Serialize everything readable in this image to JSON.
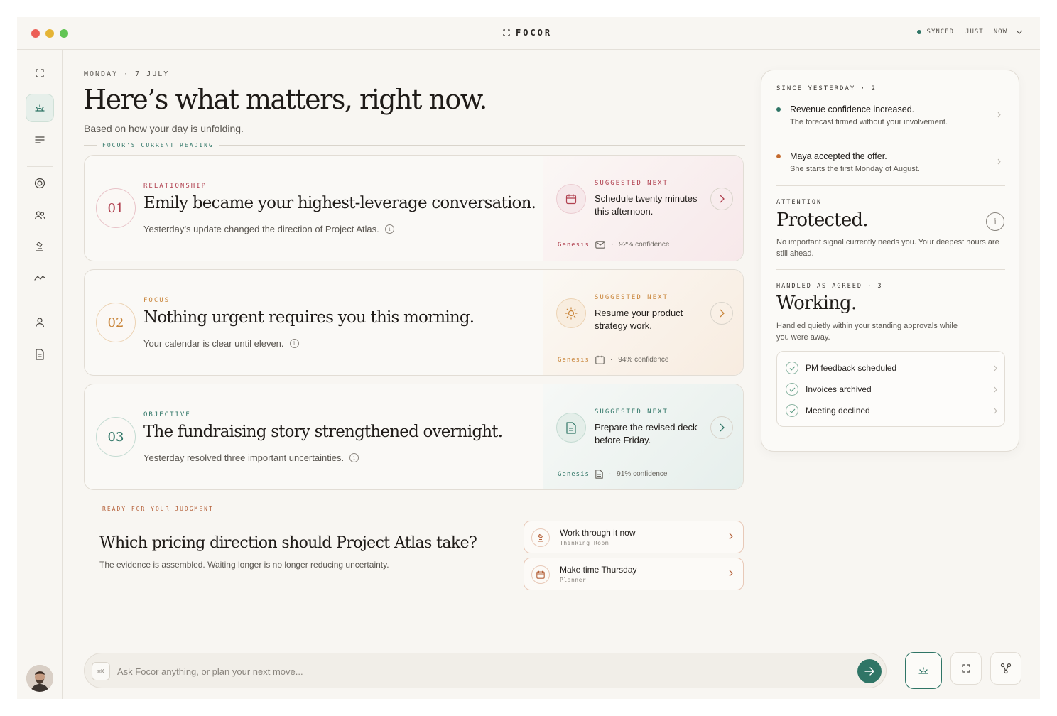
{
  "app": {
    "brand": "FOCOR",
    "sync_status": "SYNCED",
    "sync_time1": "JUST",
    "sync_time2": "NOW"
  },
  "header": {
    "date": "MONDAY · 7 JULY",
    "headline": "Here’s what matters, right now.",
    "subtitle": "Based on how your day is unfolding.",
    "reading_label": "FOCOR'S CURRENT READING"
  },
  "cards": [
    {
      "num": "01",
      "tag": "RELATIONSHIP",
      "title": "Emily became your highest-leverage conversation.",
      "desc": "Yesterday’s update changed the direction of Project Atlas.",
      "suggested_label": "SUGGESTED NEXT",
      "suggested": "Schedule twenty minutes this afternoon.",
      "source": "Genesis",
      "confidence": "92% confidence",
      "icon": "calendar-icon"
    },
    {
      "num": "02",
      "tag": "FOCUS",
      "title": "Nothing urgent requires you this morning.",
      "desc": "Your calendar is clear until eleven.",
      "suggested_label": "SUGGESTED NEXT",
      "suggested": "Resume your product strategy work.",
      "source": "Genesis",
      "confidence": "94% confidence",
      "icon": "sun-icon"
    },
    {
      "num": "03",
      "tag": "OBJECTIVE",
      "title": "The fundraising story strengthened overnight.",
      "desc": "Yesterday resolved three important uncertainties.",
      "suggested_label": "SUGGESTED NEXT",
      "suggested": "Prepare the revised deck before Friday.",
      "source": "Genesis",
      "confidence": "91% confidence",
      "icon": "document-icon"
    }
  ],
  "judgment": {
    "label": "READY FOR YOUR JUDGMENT",
    "question": "Which pricing direction should Project Atlas take?",
    "sub": "The evidence is assembled. Waiting longer is no longer reducing uncertainty.",
    "actions": [
      {
        "title": "Work through it now",
        "sub": "Thinking Room"
      },
      {
        "title": "Make time Thursday",
        "sub": "Planner"
      }
    ]
  },
  "panel": {
    "since_label": "SINCE YESTERDAY · 2",
    "since_items": [
      {
        "title": "Revenue confidence increased.",
        "sub": "The forecast firmed without your involvement."
      },
      {
        "title": "Maya accepted the offer.",
        "sub": "She starts the first Monday of August."
      }
    ],
    "attention_label": "ATTENTION",
    "attention_title": "Protected.",
    "attention_body": "No important signal currently needs you. Your deepest hours are still ahead.",
    "handled_label": "HANDLED AS AGREED · 3",
    "handled_title": "Working.",
    "handled_body": "Handled quietly within your standing approvals while you were away.",
    "handled_items": [
      "PM feedback scheduled",
      "Invoices archived",
      "Meeting declined"
    ]
  },
  "ask": {
    "shortcut": "⌘K",
    "placeholder": "Ask Focor anything, or plan your next move..."
  },
  "colors": {
    "accent": "#2f7566",
    "relationship": "#b0404f",
    "focus": "#c9853a",
    "objective": "#2f7566"
  }
}
